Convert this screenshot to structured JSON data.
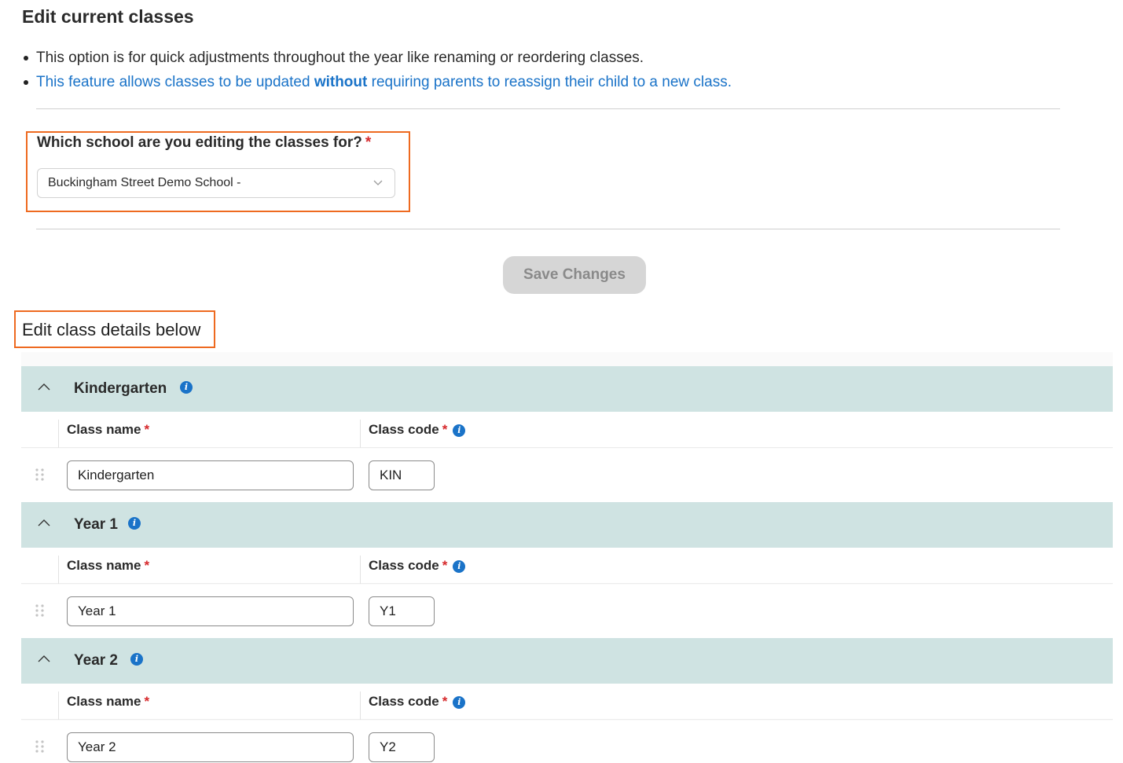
{
  "page_title": "Edit current classes",
  "bullets": {
    "first": "This option is for quick adjustments throughout the year like renaming or reordering classes.",
    "second_pre": "This feature allows classes to be updated ",
    "second_bold": "without",
    "second_post": " requiring parents to reassign their child to a new class."
  },
  "school_field": {
    "label": "Which school are you editing the classes for?",
    "required_mark": "*",
    "selected_value": "Buckingham Street Demo School -"
  },
  "save_button": "Save Changes",
  "section_title": "Edit class details below",
  "columns": {
    "class_name": "Class name",
    "class_code": "Class code",
    "required_mark": "*"
  },
  "groups": [
    {
      "title": "Kindergarten",
      "class_name_value": "Kindergarten",
      "class_code_value": "KIN"
    },
    {
      "title": "Year 1",
      "class_name_value": "Year 1",
      "class_code_value": "Y1"
    },
    {
      "title": "Year 2",
      "class_name_value": "Year 2",
      "class_code_value": "Y2"
    }
  ],
  "colors": {
    "accent_blue": "#1a73c8",
    "highlight_orange": "#ee6a20",
    "required_red": "#d6282b",
    "group_header_bg": "#cfe3e2",
    "button_disabled_bg": "#d6d6d6"
  },
  "icons": {
    "info": "info-icon",
    "caret": "chevron-up-icon",
    "drag": "drag-handle-icon",
    "select_chevron": "chevron-down-icon"
  }
}
